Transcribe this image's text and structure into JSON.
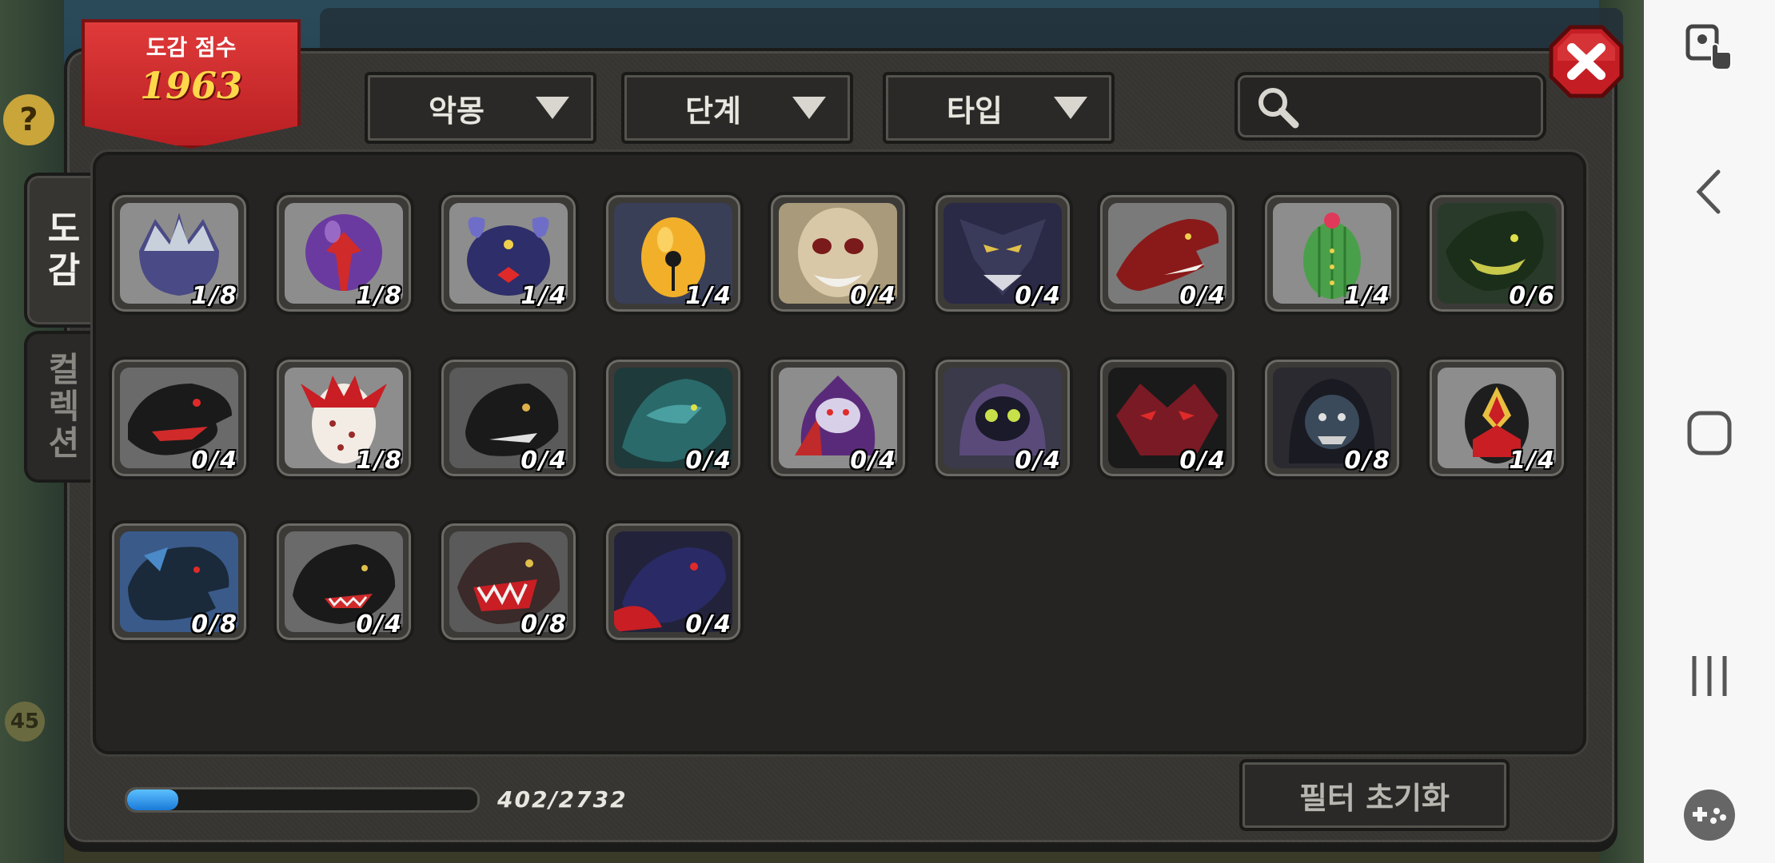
{
  "score": {
    "label": "도감 점수",
    "value": "1963"
  },
  "filters": [
    {
      "label": "악몽"
    },
    {
      "label": "단계"
    },
    {
      "label": "타입"
    }
  ],
  "search": {
    "placeholder": ""
  },
  "tabs": [
    {
      "label_line1": "도",
      "label_line2": "감",
      "active": true
    },
    {
      "label_line1": "컬",
      "label_line2": "렉",
      "label_line3": "션",
      "active": false
    }
  ],
  "cards": [
    {
      "count": "1/8"
    },
    {
      "count": "1/8"
    },
    {
      "count": "1/4"
    },
    {
      "count": "1/4"
    },
    {
      "count": "0/4"
    },
    {
      "count": "0/4"
    },
    {
      "count": "0/4"
    },
    {
      "count": "1/4"
    },
    {
      "count": "0/6"
    },
    {
      "count": "0/4"
    },
    {
      "count": "1/8"
    },
    {
      "count": "0/4"
    },
    {
      "count": "0/4"
    },
    {
      "count": "0/4"
    },
    {
      "count": "0/4"
    },
    {
      "count": "0/4"
    },
    {
      "count": "0/8"
    },
    {
      "count": "1/4"
    },
    {
      "count": "0/8"
    },
    {
      "count": "0/4"
    },
    {
      "count": "0/8"
    },
    {
      "count": "0/4"
    }
  ],
  "progress": {
    "current": 402,
    "total": 2732,
    "text": "402/2732"
  },
  "reset_label": "필터 초기화",
  "bg": {
    "level": "45",
    "help": "?"
  },
  "colors": {
    "accent": "#d12e2e",
    "score_value": "#ffd84a",
    "progress": "#2a8ae8"
  },
  "icons": {
    "search": "search-icon",
    "close": "close-icon",
    "nav_back": "back-icon",
    "nav_home": "home-icon",
    "nav_recents": "recents-icon",
    "nav_game": "gamepad-icon",
    "nav_touch": "touch-lock-icon"
  }
}
